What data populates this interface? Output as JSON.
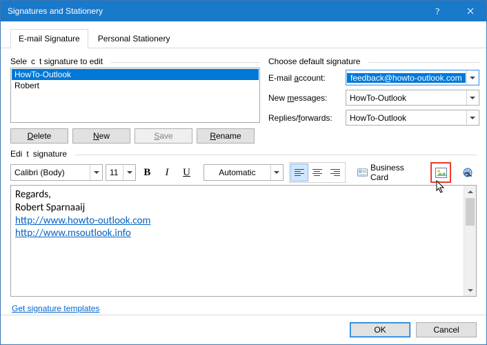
{
  "window": {
    "title": "Signatures and Stationery"
  },
  "tabs": {
    "email": "E-mail Signature",
    "stationery": "Personal Stationery",
    "active": "email"
  },
  "select_sig": {
    "label": "Select signature to edit",
    "items": [
      {
        "label": "HowTo-Outlook",
        "selected": true
      },
      {
        "label": "Robert",
        "selected": false
      }
    ]
  },
  "buttons": {
    "delete": "Delete",
    "new": "New",
    "save": "Save",
    "rename": "Rename"
  },
  "defaults": {
    "label": "Choose default signature",
    "account_label": "E-mail account:",
    "account_value": "feedback@howto-outlook.com",
    "newmsg_label": "New messages:",
    "newmsg_value": "HowTo-Outlook",
    "replies_label": "Replies/forwards:",
    "replies_value": "HowTo-Outlook"
  },
  "edit": {
    "label": "Edit signature",
    "font": "Calibri (Body)",
    "size": "11",
    "color": "Automatic",
    "bc_label": "Business Card",
    "content": {
      "line1": "Regards,",
      "line2": "Robert Sparnaaij",
      "link1": "http://www.howto-outlook.com",
      "link2": "http://www.msoutlook.info"
    }
  },
  "link_templates": "Get signature templates",
  "footer": {
    "ok": "OK",
    "cancel": "Cancel"
  }
}
